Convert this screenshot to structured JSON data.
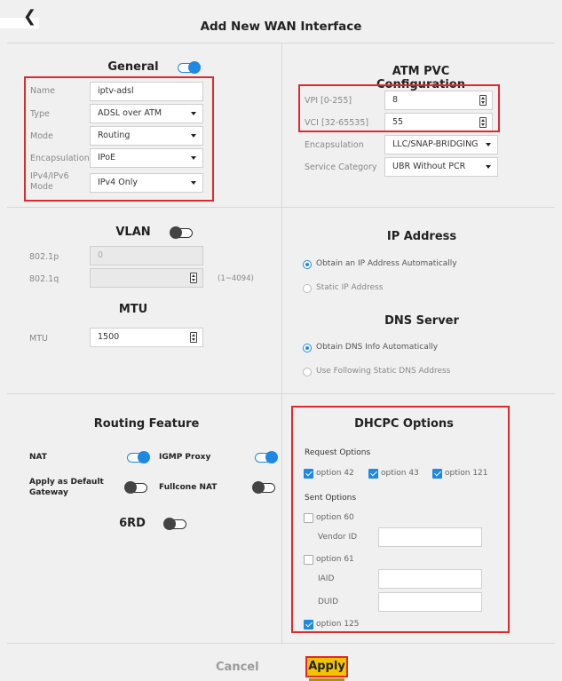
{
  "header": {
    "back_icon": "chevron-left-icon",
    "title": "Add New WAN Interface"
  },
  "general": {
    "title": "General",
    "toggle_on": true,
    "name_label": "Name",
    "name_value": "iptv-adsl",
    "type_label": "Type",
    "type_value": "ADSL over ATM",
    "mode_label": "Mode",
    "mode_value": "Routing",
    "encap_label": "Encapsulation",
    "encap_value": "IPoE",
    "ipv_label_1": "IPv4/IPv6",
    "ipv_label_2": "Mode",
    "ipv_value": "IPv4 Only"
  },
  "atm": {
    "title": "ATM PVC Configuration",
    "vpi_label": "VPI [0-255]",
    "vpi_value": "8",
    "vci_label": "VCI [32-65535]",
    "vci_value": "55",
    "encap_label": "Encapsulation",
    "encap_value": "LLC/SNAP-BRIDGING",
    "service_label": "Service Category",
    "service_value": "UBR Without PCR"
  },
  "vlan": {
    "title": "VLAN",
    "toggle_on": false,
    "p_label": "802.1p",
    "p_value": "0",
    "q_label": "802.1q",
    "q_value": "",
    "q_hint": "(1~4094)"
  },
  "mtu": {
    "title": "MTU",
    "label": "MTU",
    "value": "1500"
  },
  "ip_address": {
    "title": "IP Address",
    "option_auto": "Obtain an IP Address Automatically",
    "option_static": "Static IP Address",
    "selected": "auto"
  },
  "dns": {
    "title": "DNS Server",
    "option_auto": "Obtain DNS Info Automatically",
    "option_static": "Use Following Static DNS Address",
    "selected": "auto"
  },
  "routing": {
    "title": "Routing Feature",
    "nat_label": "NAT",
    "nat_on": true,
    "igmp_label": "IGMP Proxy",
    "igmp_on": true,
    "default_gw_label_1": "Apply as Default",
    "default_gw_label_2": "Gateway",
    "default_gw_on": false,
    "fullcone_label": "Fullcone NAT",
    "fullcone_on": false,
    "sixrd_label": "6RD",
    "sixrd_on": false
  },
  "dhcpc": {
    "title": "DHCPC Options",
    "request_label": "Request Options",
    "opt42": "option 42",
    "opt43": "option 43",
    "opt121": "option 121",
    "sent_label": "Sent Options",
    "opt60": "option 60",
    "vendor_label": "Vendor ID",
    "vendor_value": "",
    "opt61": "option 61",
    "iaid_label": "IAID",
    "iaid_value": "",
    "duid_label": "DUID",
    "duid_value": "",
    "opt125": "option 125"
  },
  "footer": {
    "cancel": "Cancel",
    "apply": "Apply"
  },
  "colors": {
    "accent": "#1e88e5",
    "highlight": "#e0282e",
    "apply_bg": "#f5c400"
  }
}
